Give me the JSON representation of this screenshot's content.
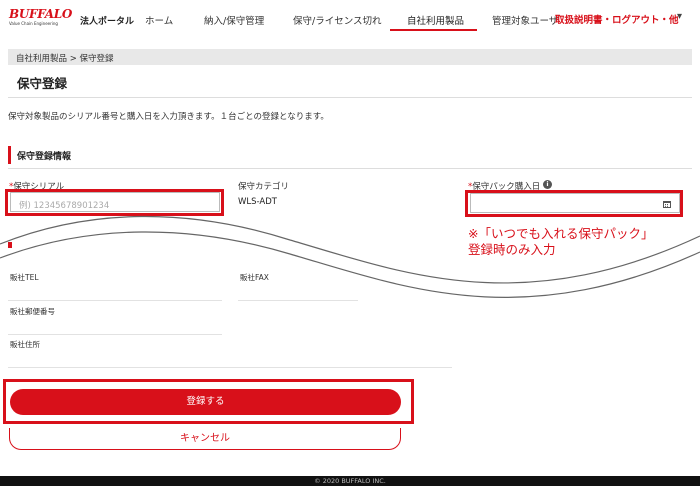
{
  "header": {
    "logo_text": "BUFFALO",
    "logo_tagline": "Value Chain Engineering",
    "portal_label": "法人ポータル",
    "nav": [
      {
        "label": "ホーム"
      },
      {
        "label": "納入/保守管理"
      },
      {
        "label": "保守/ライセンス切れ"
      },
      {
        "label": "自社利用製品"
      },
      {
        "label": "管理対象ユーザ"
      }
    ],
    "right_link": "取扱説明書・ログアウト・他",
    "right_arrow": "▾"
  },
  "breadcrumb": "自社利用製品 > 保守登録",
  "page_title": "保守登録",
  "description": "保守対象製品のシリアル番号と購入日を入力頂きます。１台ごとの登録となります。",
  "section_title": "保守登録情報",
  "fields": {
    "serial": {
      "required_mark": "*",
      "label": "保守シリアル",
      "placeholder": "例) 12345678901234",
      "value": ""
    },
    "category": {
      "label": "保守カテゴリ",
      "value": "WLS-ADT"
    },
    "purchase_date": {
      "required_mark": "*",
      "label": "保守パック購入日",
      "value": ""
    }
  },
  "info_icon": "i",
  "annotation": {
    "line1": "※「いつでも入れる保守パック」",
    "line2": "登録時のみ入力"
  },
  "lower_fields": {
    "tel": "販社TEL",
    "fax": "販社FAX",
    "postal": "販社郵便番号",
    "address": "販社住所"
  },
  "buttons": {
    "submit": "登録する",
    "cancel": "キャンセル"
  },
  "footer": "© 2020 BUFFALO INC.",
  "colors": {
    "brand_red": "#d8101a",
    "breadcrumb_bg": "#e8e8e8",
    "footer_bg": "#111111"
  },
  "icons": [
    "info-icon",
    "calendar-icon"
  ]
}
